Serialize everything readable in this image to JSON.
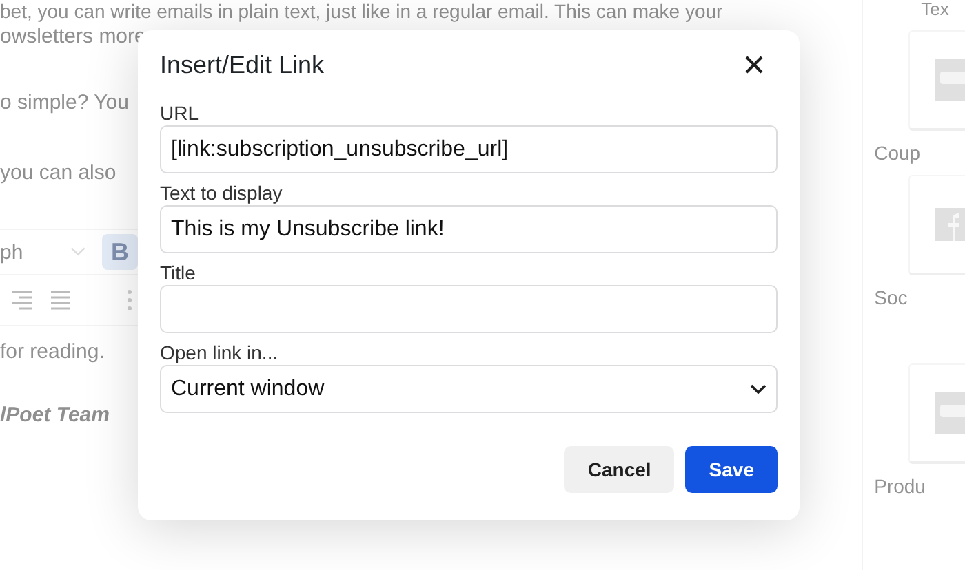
{
  "background": {
    "paragraphs": [
      "bet, you can write emails in plain text, just like in a regular email. This can make your",
      "owsletters more",
      "o simple? You",
      "you can also"
    ],
    "toolbar": {
      "format": "ph",
      "bold": "B",
      "bold_active": true
    },
    "closing": "for reading.",
    "signature": "lPoet Team"
  },
  "sidebar": {
    "heading": "Tex",
    "blocks": [
      {
        "label": "Coup",
        "kind": "woo"
      },
      {
        "label": "Soc",
        "kind": "facebook"
      },
      {
        "label": "Produ",
        "kind": "woo"
      }
    ]
  },
  "dialog": {
    "title": "Insert/Edit Link",
    "fields": [
      {
        "label": "URL",
        "kind": "text",
        "value": "[link:subscription_unsubscribe_url]"
      },
      {
        "label": "Text to display",
        "kind": "text",
        "value": "This is my Unsubscribe link!"
      },
      {
        "label": "Title",
        "kind": "text"
      },
      {
        "label": "Open link in...",
        "kind": "select",
        "value": "Current window"
      }
    ],
    "buttons": [
      {
        "label": "Cancel",
        "kind": "secondary"
      },
      {
        "label": "Save",
        "kind": "primary"
      }
    ]
  }
}
